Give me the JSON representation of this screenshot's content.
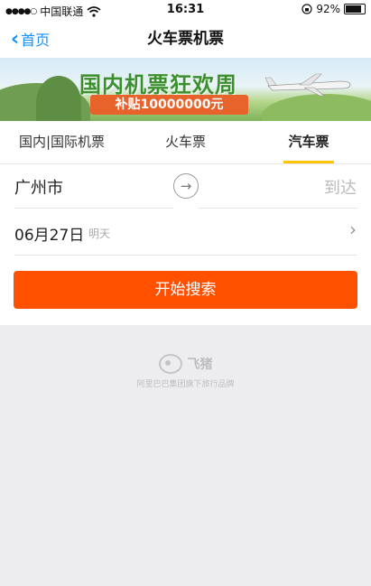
{
  "status_bar": {
    "carrier": "中国联通",
    "time": "16:31",
    "battery": "92%"
  },
  "nav": {
    "back_label": "首页",
    "title": "火车票机票"
  },
  "banner": {
    "headline": "国内机票狂欢周",
    "subsidy": "补贴10000000元"
  },
  "tabs": [
    {
      "label": "国内|国际机票",
      "active": false
    },
    {
      "label": "火车票",
      "active": false
    },
    {
      "label": "汽车票",
      "active": true
    }
  ],
  "form": {
    "from_city": "广州市",
    "to_placeholder": "到达",
    "date": "06月27日",
    "date_hint": "明天",
    "search_label": "开始搜索"
  },
  "footer": {
    "brand_name": "飞猪",
    "brand_tagline": "阿里巴巴集团旗下旅行品牌"
  },
  "colors": {
    "accent": "#ff5000",
    "link": "#1a8ff3",
    "tab_indicator": "#ffc300"
  }
}
